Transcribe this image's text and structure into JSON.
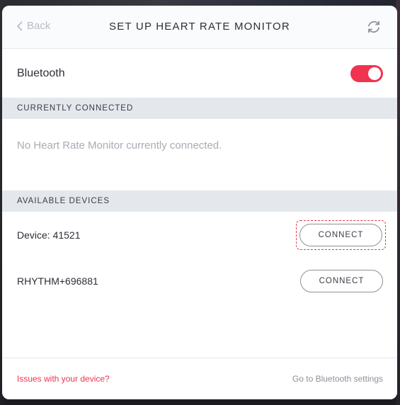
{
  "header": {
    "back_label": "Back",
    "title": "SET UP HEART RATE MONITOR",
    "refresh_icon": "refresh-icon"
  },
  "bluetooth": {
    "label": "Bluetooth",
    "enabled": true,
    "toggle_color": "#f0334f"
  },
  "currently_connected": {
    "heading": "CURRENTLY CONNECTED",
    "empty_message": "No Heart Rate Monitor currently connected."
  },
  "available_devices": {
    "heading": "AVAILABLE DEVICES",
    "devices": [
      {
        "name": "Device: 41521",
        "button_label": "CONNECT",
        "highlighted": true
      },
      {
        "name": "RHYTHM+696881",
        "button_label": "CONNECT",
        "highlighted": false
      }
    ]
  },
  "footer": {
    "issues_link": "Issues with your device?",
    "settings_link": "Go to Bluetooth settings"
  },
  "colors": {
    "accent": "#f0334f",
    "highlight_border": "#e23a4a"
  }
}
